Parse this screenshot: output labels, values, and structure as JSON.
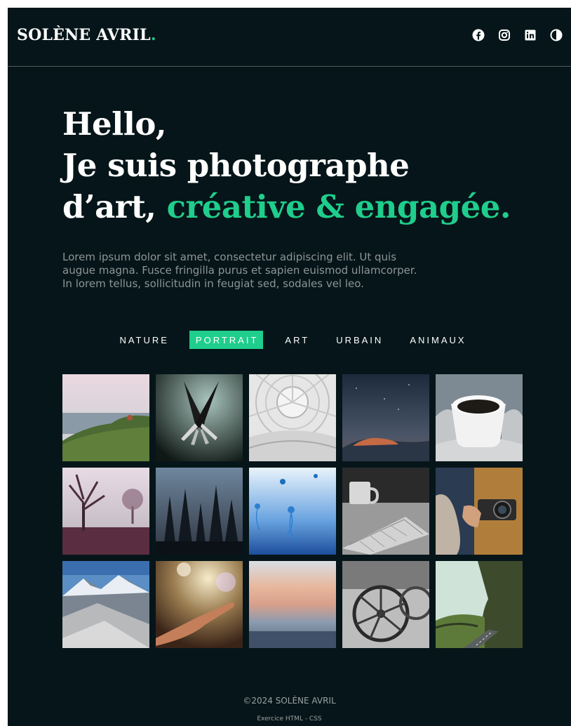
{
  "brand": {
    "name": "SOLÈNE AVRIL",
    "dot": ".",
    "accent_color": "#1fce8c"
  },
  "social": [
    {
      "icon": "facebook-icon"
    },
    {
      "icon": "instagram-icon"
    },
    {
      "icon": "linkedin-icon"
    },
    {
      "icon": "contrast-toggle-icon"
    }
  ],
  "hero": {
    "line1": "Hello,",
    "line2": "Je suis photographe",
    "line3_plain": "d’art, ",
    "line3_accent": "créative & engagée."
  },
  "intro": "Lorem ipsum dolor sit amet, consectetur adipiscing elit. Ut quis augue magna. Fusce fringilla purus et sapien euismod ullamcorper. In lorem tellus, sollicitudin in feugiat sed, sodales vel leo.",
  "filters": [
    {
      "label": "NATURE",
      "active": false
    },
    {
      "label": "PORTRAIT",
      "active": true
    },
    {
      "label": "ART",
      "active": false
    },
    {
      "label": "URBAIN",
      "active": false
    },
    {
      "label": "ANIMAUX",
      "active": false
    }
  ],
  "gallery": [
    {
      "subject": "coastal-cliff-photo"
    },
    {
      "subject": "forks-photo"
    },
    {
      "subject": "dome-architecture-photo"
    },
    {
      "subject": "night-sky-landscape-photo"
    },
    {
      "subject": "coffee-cup-photo"
    },
    {
      "subject": "misty-trees-photo"
    },
    {
      "subject": "forest-photo"
    },
    {
      "subject": "jellyfish-photo"
    },
    {
      "subject": "keyboard-mug-photo"
    },
    {
      "subject": "camera-hands-photo"
    },
    {
      "subject": "mountains-photo"
    },
    {
      "subject": "reaching-hand-photo"
    },
    {
      "subject": "sunset-sea-photo"
    },
    {
      "subject": "wagon-wheels-photo"
    },
    {
      "subject": "cliff-road-photo"
    }
  ],
  "footer": {
    "copyright": "©2024 SOLÈNE AVRIL",
    "note": "Exercice HTML - CSS"
  }
}
